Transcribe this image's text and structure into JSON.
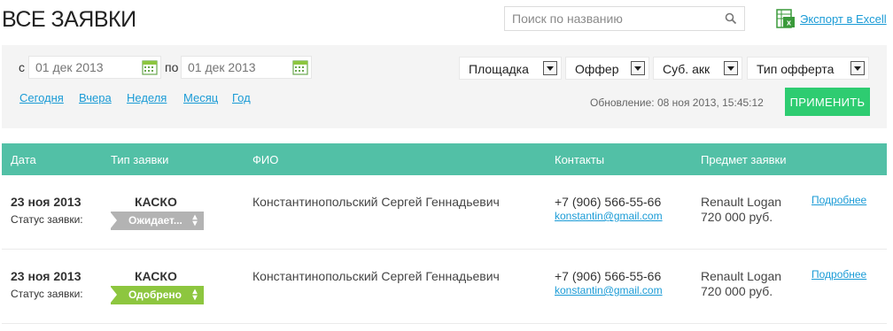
{
  "header": {
    "title": "ВСЕ ЗАЯВКИ",
    "search_placeholder": "Поиск по названию",
    "export_label": "Экспорт в Excell"
  },
  "filters": {
    "from_label": "с",
    "to_label": "по",
    "date_from_placeholder": "01 дек 2013",
    "date_to_placeholder": "01 дек 2013",
    "selects": [
      {
        "label": "Площадка"
      },
      {
        "label": "Оффер"
      },
      {
        "label": "Суб. акк"
      },
      {
        "label": "Тип офферта"
      }
    ],
    "quick_links": [
      "Сегодня",
      "Вчера",
      "Неделя",
      "Месяц",
      "Год"
    ],
    "update_text": "Обновление: 08 ноя 2013, 15:45:12",
    "apply_label": "ПРИМЕНИТЬ"
  },
  "table": {
    "columns": [
      "Дата",
      "Тип заявки",
      "ФИО",
      "Контакты",
      "Предмет заявки"
    ],
    "rows": [
      {
        "date": "23 ноя 2013",
        "status_label": "Статус заявки:",
        "type": "КАСКО",
        "status": "Ожидает...",
        "name": "Константинопольский Сергей Геннадьевич",
        "phone": "+7 (906) 566-55-66",
        "email": "konstantin@gmail.com",
        "subject_line1": "Renault Logan",
        "subject_line2": "720 000 руб.",
        "more_label": "Подробнее"
      },
      {
        "date": "23 ноя 2013",
        "status_label": "Статус заявки:",
        "type": "КАСКО",
        "status": "Одобрено",
        "name": "Константинопольский Сергей Геннадьевич",
        "phone": "+7 (906) 566-55-66",
        "email": "konstantin@gmail.com",
        "subject_line1": "Renault Logan",
        "subject_line2": "720 000 руб.",
        "more_label": "Подробнее"
      }
    ]
  },
  "colors": {
    "header_bg": "#52c0a6",
    "apply_bg": "#2ecc71",
    "status_waiting": "#b3b3b3",
    "status_approved": "#8dc63f",
    "link": "#1a9bd6"
  }
}
